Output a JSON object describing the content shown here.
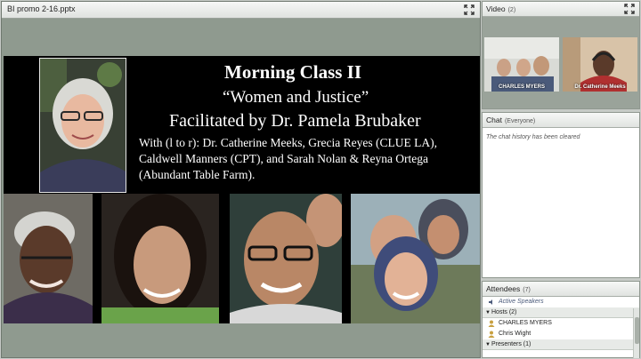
{
  "share": {
    "title": "BI promo 2-16.pptx",
    "slide": {
      "line1": "Morning Class II",
      "line2": "“Women and Justice”",
      "line3": "Facilitated by Dr. Pamela Brubaker",
      "line4": "With (l to r): Dr. Catherine Meeks, Grecia Reyes (CLUE LA), Caldwell Manners (CPT), and Sarah Nolan & Reyna Ortega (Abundant Table Farm)."
    }
  },
  "video": {
    "title": "Video",
    "count": "(2)",
    "feeds": [
      {
        "label": "CHARLES MYERS"
      },
      {
        "label": "Dr. Catherine Meeks"
      }
    ]
  },
  "chat": {
    "title": "Chat",
    "scope": "(Everyone)",
    "message": "The chat history has been cleared"
  },
  "attendees": {
    "title": "Attendees",
    "count": "(7)",
    "active_speakers": "Active Speakers",
    "hosts_label": "Hosts (2)",
    "hosts": [
      "CHARLES MYERS",
      "Chris Wight"
    ],
    "presenters_label": "Presenters (1)"
  },
  "colors": {
    "pod_bg": "#8f9a8f",
    "slide_bg": "#000000",
    "header_bg": "#eceeec"
  }
}
